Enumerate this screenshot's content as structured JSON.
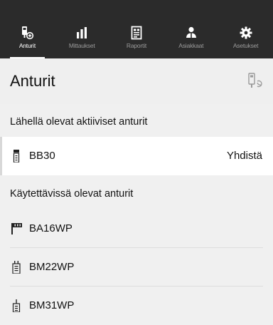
{
  "nav": {
    "tabs": [
      {
        "label": "Anturit",
        "icon": "sensor-icon",
        "active": true
      },
      {
        "label": "Mittaukset",
        "icon": "bar-chart-icon",
        "active": false
      },
      {
        "label": "Raportit",
        "icon": "report-icon",
        "active": false
      },
      {
        "label": "Asiakkaat",
        "icon": "customers-icon",
        "active": false
      },
      {
        "label": "Asetukset",
        "icon": "gear-icon",
        "active": false
      }
    ]
  },
  "header": {
    "title": "Anturit",
    "refresh_icon": "sensor-refresh-icon"
  },
  "nearby": {
    "title": "Lähellä olevat aktiiviset anturit",
    "items": [
      {
        "name": "BB30",
        "action": "Yhdistä",
        "icon": "probe-icon"
      }
    ]
  },
  "available": {
    "title": "Käytettävissä olevat anturit",
    "items": [
      {
        "name": "BA16WP",
        "icon": "ba-probe-icon"
      },
      {
        "name": "BM22WP",
        "icon": "bm22-probe-icon"
      },
      {
        "name": "BM31WP",
        "icon": "bm31-probe-icon"
      }
    ]
  },
  "colors": {
    "topbar": "#2b2b2b",
    "background": "#f0f0f0",
    "row_highlight": "#ffffff",
    "divider": "#dddddd"
  }
}
